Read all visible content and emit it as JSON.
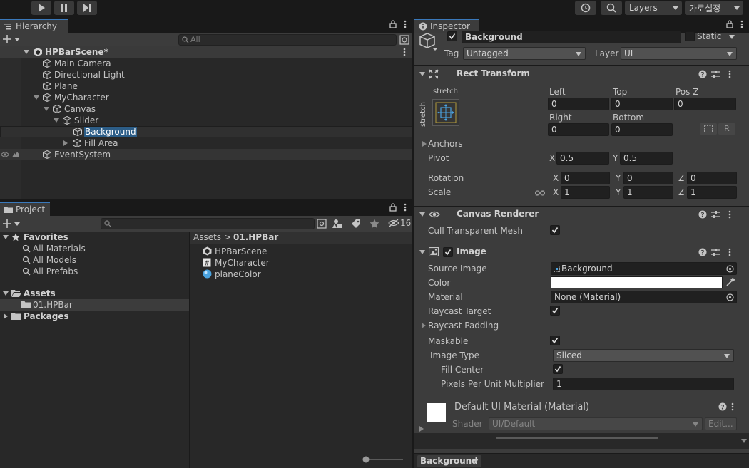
{
  "toolbar": {
    "layers_label": "Layers",
    "layout_label": "가로설정"
  },
  "hierarchy": {
    "tab_label": "Hierarchy",
    "search_placeholder": "All",
    "scene_name": "HPBarScene*",
    "items": [
      {
        "label": "Main Camera"
      },
      {
        "label": "Directional Light"
      },
      {
        "label": "Plane"
      },
      {
        "label": "MyCharacter"
      },
      {
        "label": "Canvas"
      },
      {
        "label": "Slider"
      },
      {
        "label": "Background"
      },
      {
        "label": "Fill Area"
      },
      {
        "label": "EventSystem"
      }
    ]
  },
  "project": {
    "tab_label": "Project",
    "hidden_count": "16",
    "tree": {
      "favorites": "Favorites",
      "fav_items": [
        "All Materials",
        "All Models",
        "All Prefabs"
      ],
      "assets": "Assets",
      "asset_items": [
        "01.HPBar"
      ],
      "packages": "Packages"
    },
    "breadcrumb": {
      "root": "Assets",
      "sep": ">",
      "current": "01.HPBar"
    },
    "files": [
      {
        "label": "HPBarScene",
        "icon": "unity-scene-icon"
      },
      {
        "label": "MyCharacter",
        "icon": "csharp-script-icon"
      },
      {
        "label": "planeColor",
        "icon": "material-sphere-icon"
      }
    ]
  },
  "inspector": {
    "tab_label": "Inspector",
    "object_name": "Background",
    "static_label": "Static",
    "tag_label": "Tag",
    "tag_value": "Untagged",
    "layer_label": "Layer",
    "layer_value": "UI",
    "rect_transform": {
      "title": "Rect Transform",
      "anchor_h": "stretch",
      "anchor_v": "stretch",
      "left_label": "Left",
      "left": "0",
      "top_label": "Top",
      "top": "0",
      "posz_label": "Pos Z",
      "posz": "0",
      "right_label": "Right",
      "right": "0",
      "bottom_label": "Bottom",
      "bottom": "0",
      "r_button": "R",
      "anchors_label": "Anchors",
      "pivot_label": "Pivot",
      "pivot_x": "0.5",
      "pivot_y": "0.5",
      "rotation_label": "Rotation",
      "rot_x": "0",
      "rot_y": "0",
      "rot_z": "0",
      "scale_label": "Scale",
      "scale_x": "1",
      "scale_y": "1",
      "scale_z": "1",
      "x": "X",
      "y": "Y",
      "z": "Z"
    },
    "canvas_renderer": {
      "title": "Canvas Renderer",
      "cull_label": "Cull Transparent Mesh"
    },
    "image": {
      "title": "Image",
      "source_label": "Source Image",
      "source_value": "Background",
      "color_label": "Color",
      "color_value": "#ffffff",
      "material_label": "Material",
      "material_value": "None (Material)",
      "raycast_target_label": "Raycast Target",
      "raycast_padding_label": "Raycast Padding",
      "maskable_label": "Maskable",
      "image_type_label": "Image Type",
      "image_type_value": "Sliced",
      "fill_center_label": "Fill Center",
      "ppu_label": "Pixels Per Unit Multiplier",
      "ppu_value": "1"
    },
    "material": {
      "title": "Default UI Material (Material)",
      "shader_label": "Shader",
      "shader_value": "UI/Default",
      "edit_label": "Edit..."
    },
    "footer_label": "Background"
  },
  "colors": {
    "accent": "#3a79bb",
    "selection": "#2c5d87",
    "panel": "#282828",
    "inspector": "#3c3c3c"
  }
}
